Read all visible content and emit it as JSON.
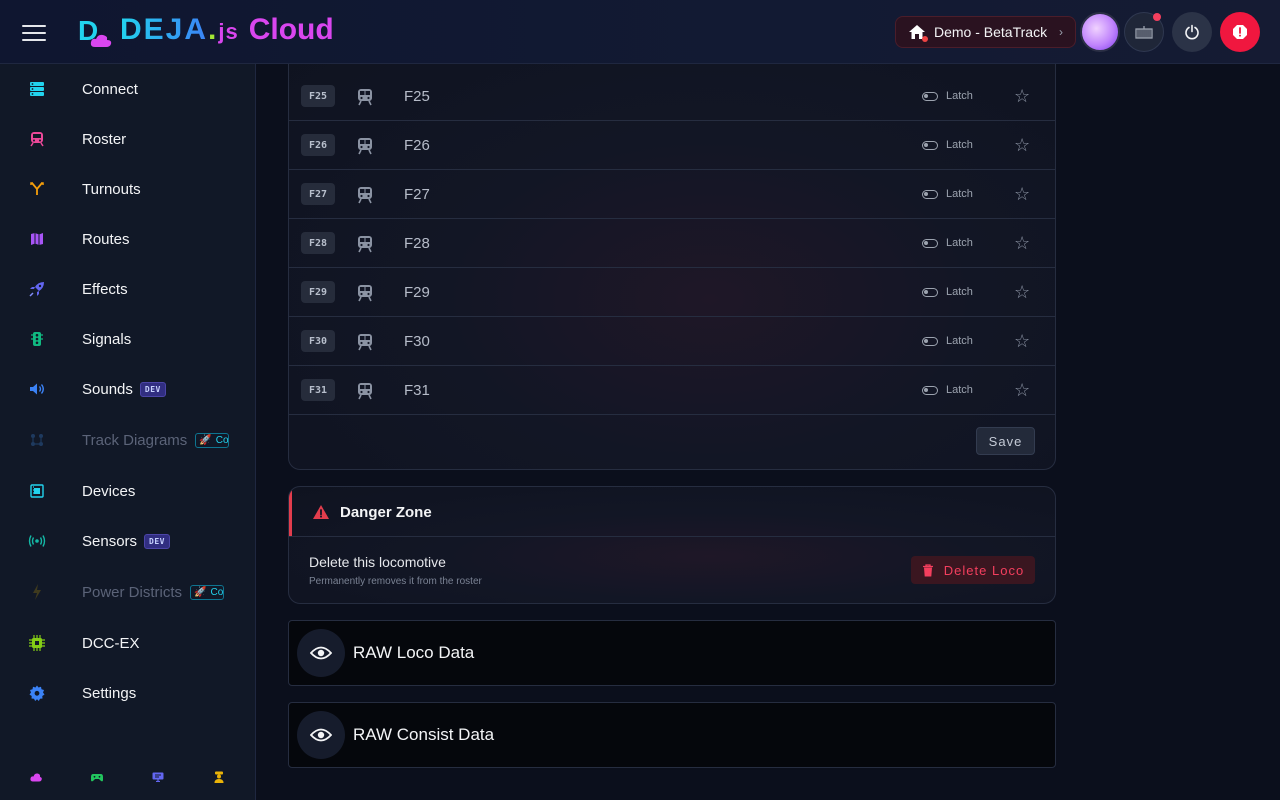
{
  "header": {
    "brand_deja": "DEJA",
    "brand_dot": ".",
    "brand_js": "js",
    "brand_cloud": "Cloud",
    "layout_label": "Demo - BetaTrack",
    "colors": {
      "cyan": "#22d3ee",
      "magenta": "#d946ef",
      "danger": "#f0173f"
    }
  },
  "sidebar": {
    "items": [
      {
        "label": "Connect",
        "icon": "server-icon",
        "color": "#22d3ee"
      },
      {
        "label": "Roster",
        "icon": "train-icon",
        "color": "#ec4899"
      },
      {
        "label": "Turnouts",
        "icon": "fork-icon",
        "color": "#f59e0b"
      },
      {
        "label": "Routes",
        "icon": "map-icon",
        "color": "#a855f7"
      },
      {
        "label": "Effects",
        "icon": "rocket-icon",
        "color": "#6366f1"
      },
      {
        "label": "Signals",
        "icon": "traffic-light-icon",
        "color": "#10b981"
      },
      {
        "label": "Sounds",
        "icon": "speaker-icon",
        "color": "#3b82f6",
        "badge": "DEV"
      },
      {
        "label": "Track Diagrams",
        "icon": "diagram-icon",
        "color": "#1e3a5f",
        "badge_co": "Co",
        "disabled": true
      },
      {
        "label": "Devices",
        "icon": "chip-icon",
        "color": "#22d3ee"
      },
      {
        "label": "Sensors",
        "icon": "broadcast-icon",
        "color": "#14b8a6",
        "badge": "DEV"
      },
      {
        "label": "Power Districts",
        "icon": "lightning-icon",
        "color": "#3f3a1e",
        "badge_co": "Co",
        "disabled": true
      },
      {
        "label": "DCC-EX",
        "icon": "cpu-icon",
        "color": "#84cc16"
      },
      {
        "label": "Settings",
        "icon": "gear-icon",
        "color": "#3b82f6"
      }
    ],
    "footer_icons": [
      {
        "name": "cloud-icon",
        "color": "#d946ef"
      },
      {
        "name": "gamepad-icon",
        "color": "#22c55e"
      },
      {
        "name": "monitor-icon",
        "color": "#6366f1"
      },
      {
        "name": "conductor-icon",
        "color": "#eab308"
      }
    ]
  },
  "functions": {
    "rows": [
      {
        "code": "F25",
        "name": "F25",
        "mode": "Latch"
      },
      {
        "code": "F26",
        "name": "F26",
        "mode": "Latch"
      },
      {
        "code": "F27",
        "name": "F27",
        "mode": "Latch"
      },
      {
        "code": "F28",
        "name": "F28",
        "mode": "Latch"
      },
      {
        "code": "F29",
        "name": "F29",
        "mode": "Latch"
      },
      {
        "code": "F30",
        "name": "F30",
        "mode": "Latch"
      },
      {
        "code": "F31",
        "name": "F31",
        "mode": "Latch"
      }
    ],
    "save_label": "Save"
  },
  "danger": {
    "title": "Danger Zone",
    "heading": "Delete this locomotive",
    "subtext": "Permanently removes it from the roster",
    "delete_label": "Delete Loco"
  },
  "raw": {
    "loco_label": "RAW Loco Data",
    "consist_label": "RAW Consist Data"
  }
}
